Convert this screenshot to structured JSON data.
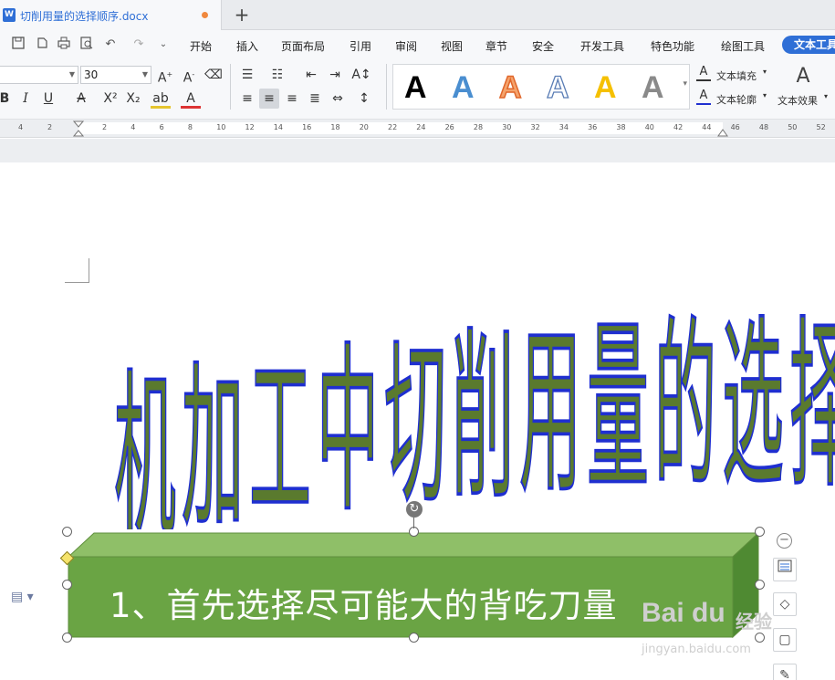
{
  "window": {
    "doc_title": "切削用量的选择顺序.docx",
    "app_badge": "W",
    "new_tab": "+"
  },
  "menu": {
    "items": [
      "开始",
      "插入",
      "页面布局",
      "引用",
      "审阅",
      "视图",
      "章节",
      "安全",
      "开发工具",
      "特色功能",
      "绘图工具"
    ],
    "active": "文本工具"
  },
  "format": {
    "font_name": "",
    "font_size": "30"
  },
  "styles_gallery": [
    "A",
    "A",
    "A",
    "A",
    "A",
    "A"
  ],
  "ribbon_right": {
    "fill_label": "文本填充",
    "outline_label": "文本轮廓",
    "effect_label": "文本效果"
  },
  "ruler": {
    "left_labels": [
      "4",
      "2"
    ],
    "labels": [
      "2",
      "4",
      "6",
      "8",
      "10",
      "12",
      "14",
      "16",
      "18",
      "20",
      "22",
      "24",
      "26",
      "28",
      "30",
      "32",
      "34",
      "36",
      "38",
      "40",
      "42",
      "44",
      "46",
      "48",
      "50",
      "52"
    ]
  },
  "document": {
    "wordart": "机加工中切削用量的选择",
    "shape_text": "1、首先选择尽可能大的背吃刀量"
  },
  "watermark": {
    "logo": "Bai du",
    "brand": "经验",
    "url": "jingyan.baidu.com"
  },
  "colors": {
    "accent": "#2f6fd6",
    "wordart_fill": "#5a7a2e",
    "wordart_outline": "#1f2fd0",
    "shape_face": "#6aa444",
    "shape_top": "#8fbf68",
    "shape_side": "#4f8a32"
  }
}
